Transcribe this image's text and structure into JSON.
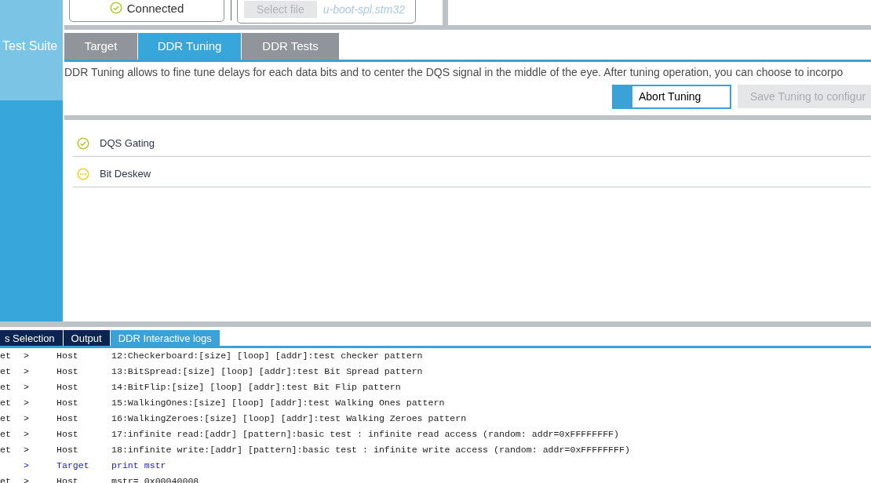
{
  "connection": {
    "status": "Connected",
    "ok": true
  },
  "file": {
    "button": "Select file",
    "button_disabled": true,
    "name": "u-boot-spl.stm32"
  },
  "sidebar": {
    "label": "Test Suite"
  },
  "tabs": [
    {
      "label": "Target",
      "selected": false
    },
    {
      "label": "DDR Tuning",
      "selected": true
    },
    {
      "label": "DDR Tests",
      "selected": false
    }
  ],
  "description": "DDR Tuning allows to fine tune delays for each data bits and to center the DQS signal in the middle of the eye. After tuning operation, you can choose to incorpo",
  "buttons": [
    {
      "label": "Abort Tuning",
      "disabled": false
    },
    {
      "label": "Save Tuning to configur",
      "disabled": true
    }
  ],
  "steps": [
    {
      "label": "DQS Gating",
      "kind": "done"
    },
    {
      "label": "Bit Deskew",
      "kind": "running"
    }
  ],
  "log_tabs": [
    {
      "label": "s Selection",
      "selected": false
    },
    {
      "label": "Output",
      "selected": false
    },
    {
      "label": "DDR Interactive logs",
      "selected": true
    }
  ],
  "log": [
    {
      "kind": "host",
      "column_1": "et",
      "direction": ">",
      "source": "Host",
      "message": "12:Checkerboard:[size] [loop] [addr]:test checker pattern"
    },
    {
      "kind": "host",
      "column_1": "et",
      "direction": ">",
      "source": "Host",
      "message": "13:BitSpread:[size] [loop] [addr]:test Bit Spread pattern"
    },
    {
      "kind": "host",
      "column_1": "et",
      "direction": ">",
      "source": "Host",
      "message": "14:BitFlip:[size] [loop] [addr]:test Bit Flip pattern"
    },
    {
      "kind": "host",
      "column_1": "et",
      "direction": ">",
      "source": "Host",
      "message": "15:WalkingOnes:[size] [loop] [addr]:test Walking Ones pattern"
    },
    {
      "kind": "host",
      "column_1": "et",
      "direction": ">",
      "source": "Host",
      "message": "16:WalkingZeroes:[size] [loop] [addr]:test Walking Zeroes pattern"
    },
    {
      "kind": "host",
      "column_1": "et",
      "direction": ">",
      "source": "Host",
      "message": "17:infinite read:[addr] [pattern]:basic test : infinite read access (random: addr=0xFFFFFFFF)"
    },
    {
      "kind": "host",
      "column_1": "et",
      "direction": ">",
      "source": "Host",
      "message": "18:infinite write:[addr] [pattern]:basic test : infinite write access (random: addr=0xFFFFFFFF)"
    },
    {
      "kind": "target",
      "direction": ">",
      "source": "Target",
      "message": "print mstr"
    },
    {
      "kind": "host",
      "column_1": "et",
      "direction": ">",
      "source": "Host",
      "message": "mstr= 0x00040008"
    }
  ]
}
